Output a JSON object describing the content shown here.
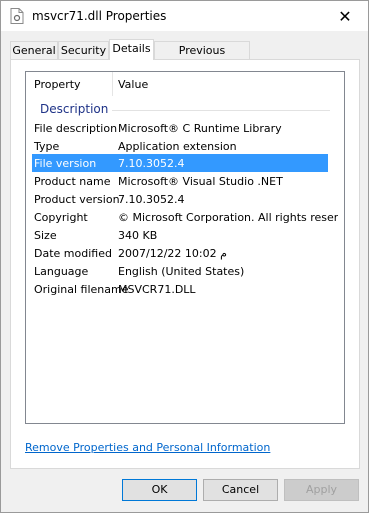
{
  "window": {
    "title": "msvcr71.dll Properties",
    "close_glyph": "✕"
  },
  "tabs": [
    {
      "label": "General"
    },
    {
      "label": "Security"
    },
    {
      "label": "Details",
      "active": true
    },
    {
      "label": "Previous Versions"
    }
  ],
  "list": {
    "headers": {
      "property": "Property",
      "value": "Value"
    },
    "group": "Description",
    "rows": [
      {
        "k": "File description",
        "v": "Microsoft® C Runtime Library"
      },
      {
        "k": "Type",
        "v": "Application extension"
      },
      {
        "k": "File version",
        "v": "7.10.3052.4",
        "selected": true
      },
      {
        "k": "Product name",
        "v": "Microsoft® Visual Studio .NET"
      },
      {
        "k": "Product version",
        "v": "7.10.3052.4"
      },
      {
        "k": "Copyright",
        "v": "© Microsoft Corporation.  All rights reser..."
      },
      {
        "k": "Size",
        "v": "340 KB"
      },
      {
        "k": "Date modified",
        "v": "2007/12/22 ‏م 10:02"
      },
      {
        "k": "Language",
        "v": "English (United States)"
      },
      {
        "k": "Original filename",
        "v": "MSVCR71.DLL"
      }
    ]
  },
  "link": "Remove Properties and Personal Information",
  "buttons": {
    "ok": "OK",
    "cancel": "Cancel",
    "apply": "Apply"
  },
  "colors": {
    "selection": "#3399ff",
    "link": "#0066cc",
    "group_header": "#1e3287"
  }
}
